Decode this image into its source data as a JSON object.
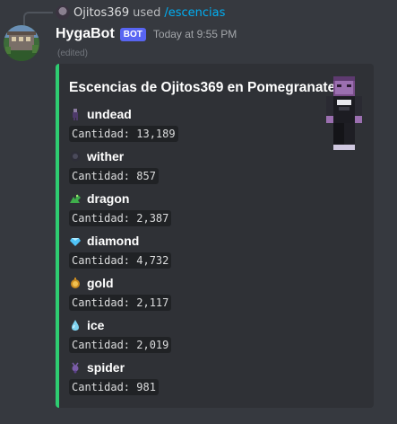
{
  "reply": {
    "user": "Ojitos369",
    "used": "used",
    "command": "/escencias"
  },
  "author": {
    "name": "HygaBot",
    "tag": "BOT",
    "timestamp": "Today at 9:55 PM",
    "edited": "(edited)"
  },
  "embed": {
    "accent_color": "#2ecc71",
    "title": "Escencias de Ojitos369 en Pomegranate",
    "fields": [
      {
        "name": "undead",
        "value": "Cantidad: 13,189",
        "icon": "undead-icon",
        "color": "#5a3f7a"
      },
      {
        "name": "wither",
        "value": "Cantidad: 857",
        "icon": "wither-icon",
        "color": "#3c3c48"
      },
      {
        "name": "dragon",
        "value": "Cantidad: 2,387",
        "icon": "dragon-icon",
        "color": "#3fae4b"
      },
      {
        "name": "diamond",
        "value": "Cantidad: 4,732",
        "icon": "diamond-icon",
        "color": "#4fc3f7"
      },
      {
        "name": "gold",
        "value": "Cantidad: 2,117",
        "icon": "gold-icon",
        "color": "#e0a030"
      },
      {
        "name": "ice",
        "value": "Cantidad: 2,019",
        "icon": "ice-icon",
        "color": "#7fd3f0"
      },
      {
        "name": "spider",
        "value": "Cantidad: 981",
        "icon": "spider-icon",
        "color": "#7a5ca8"
      }
    ]
  },
  "colors": {
    "background": "#36393f",
    "embed_background": "#2f3136",
    "link": "#00aff4",
    "bot_tag": "#5865f2"
  }
}
